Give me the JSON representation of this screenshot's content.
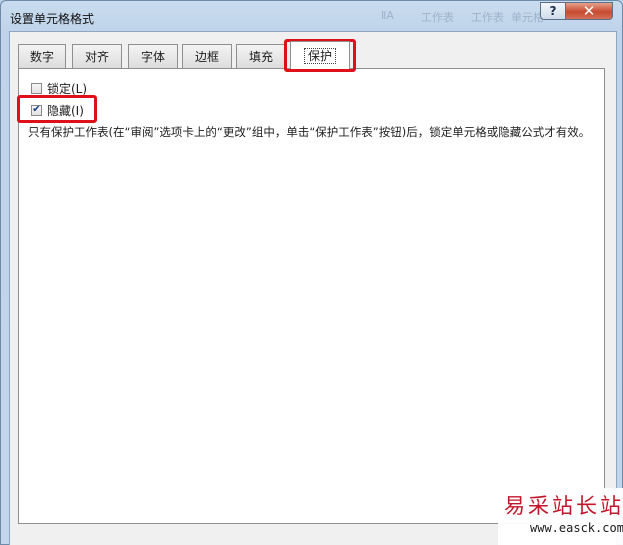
{
  "window": {
    "title": "设置单元格格式",
    "help_label": "?",
    "close_label": "✕"
  },
  "background_ghost_text": [
    "ⅡA",
    "工作表",
    "工作表",
    "单元格"
  ],
  "tabs": [
    {
      "label": "数字"
    },
    {
      "label": "对齐"
    },
    {
      "label": "字体"
    },
    {
      "label": "边框"
    },
    {
      "label": "填充"
    },
    {
      "label": "保护",
      "active": true
    }
  ],
  "protection": {
    "locked": {
      "label": "锁定(L)",
      "checked": false
    },
    "hidden": {
      "label": "隐藏(I)",
      "checked": true
    },
    "note": "只有保护工作表(在“审阅”选项卡上的“更改”组中，单击“保护工作表”按钮)后，锁定单元格或隐藏公式才有效。"
  },
  "watermark": {
    "cn": "易采站长站",
    "en": "www.easck.com"
  },
  "colors": {
    "highlight": "#e0101a",
    "titlebar": "#bfd4ea",
    "close": "#c74a30",
    "watermark": "#c3162c"
  }
}
